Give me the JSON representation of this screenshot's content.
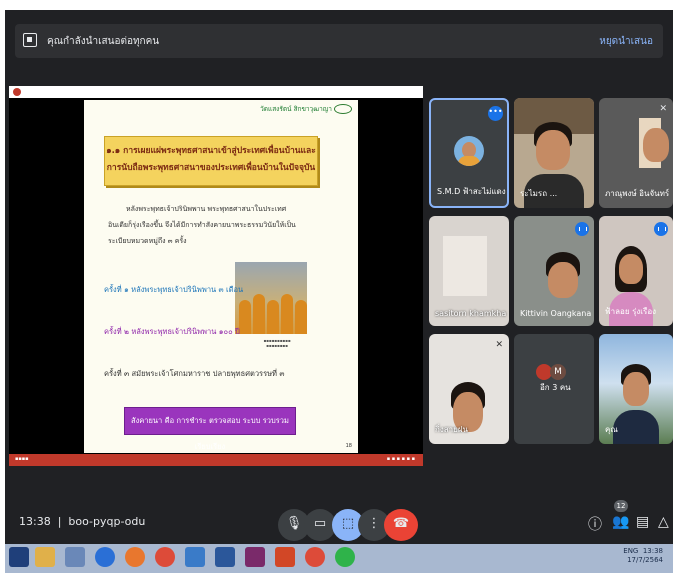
{
  "banner": {
    "text": "คุณกำลังนำเสนอต่อทุกคน",
    "stop_label": "หยุดนำเสนอ"
  },
  "slide": {
    "header": "วัดแสงรัตน์ สิกขาวุฒาญา",
    "title_line1": "๑.๑ การเผยแผ่พระพุทธศาสนาเข้าสู่ประเทศเพื่อนบ้านและ",
    "title_line2": "การนับถือพระพุทธศาสนาของประเทศเพื่อนบ้านในปัจจุบัน",
    "para_line1": "หลังพระพุทธเจ้าปรินิพพาน พระพุทธศาสนาในประเทศ",
    "para_line2": "อินเดียก็รุ่งเรืองขึ้น จึงได้มีการทำสังคายนาพระธรรมวินัยให้เป็น",
    "para_line3": "ระเบียบหมวดหมู่ถึง ๓ ครั้ง",
    "item1": "ครั้งที่ ๑ หลังพระพุทธเจ้าปรินิพพาน ๓ เดือน",
    "item2": "ครั้งที่ ๒ หลังพระพุทธเจ้าปรินิพพาน ๑๐๐ ปี",
    "item3": "ครั้งที่ ๓ สมัยพระเจ้าโศกมหาราช ปลายพุทธศตวรรษที่ ๓",
    "button": "สังคายนา คือ การชำระ ตรวจสอบ ระบบ รวบรวมเรียบเรียง",
    "page_num": "18"
  },
  "participants": [
    {
      "name": "S.M.D ฟ้าสะไม่แดง"
    },
    {
      "name": "ระไมรถ ..."
    },
    {
      "name": "ภาณุพงษ์ อินจันทร์"
    },
    {
      "name": "sasitorn khamkha"
    },
    {
      "name": "Kittivin Oangkana"
    },
    {
      "name": "ฟ้าลอย รุ่งเรือง"
    },
    {
      "name": "กิ่งสายฝน"
    },
    {
      "name": "อีก 3 คน",
      "avatar": "M"
    },
    {
      "name": "คุณ"
    }
  ],
  "meeting": {
    "time": "13:38",
    "code": "boo-pyqp-odu",
    "participant_count": "12"
  },
  "taskbar": {
    "lang": "ENG",
    "time": "13:38",
    "date": "17/7/2564"
  }
}
